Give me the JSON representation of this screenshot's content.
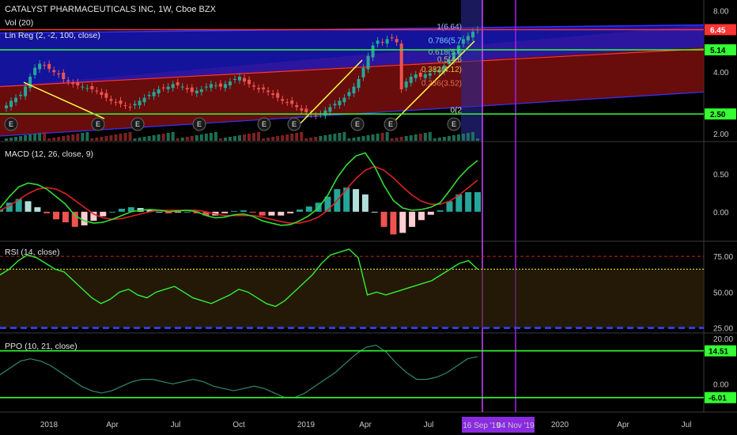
{
  "header": {
    "title": "CATALYST PHARMACEUTICALS INC, 1W, Cboe BZX",
    "vol_label": "Vol (20)",
    "linreg_label": "Lin Reg (2, -2, 100, close)"
  },
  "indicators": {
    "macd_label": "MACD (12, 26, close, 9)",
    "rsi_label": "RSI (14, close)",
    "ppo_label": "PPO (10, 21, close)"
  },
  "colors": {
    "background": "#000000",
    "bull_candle": "#26a69a",
    "bear_candle": "#ef5350",
    "horizontal_green": "#33ff33",
    "horizontal_red": "#ff3333",
    "trend_yellow": "#ffff44",
    "linreg_blue": "#1a1ad0",
    "linreg_red": "#8b1010",
    "macd_line": "#33dd33",
    "signal_line": "#dd2222",
    "rsi_line": "#33ee33",
    "ppo_line": "#2e8b6e",
    "vertical_purple": "#a020f0",
    "highlight_purple": "#8a2be2"
  },
  "chart_data": [
    {
      "type": "candlestick",
      "pane": "price",
      "scale": "log",
      "y_ticks": [
        "8.00",
        "4.00",
        "2.00"
      ],
      "ylim": [
        1.85,
        9.0
      ],
      "horizontal_levels": [
        {
          "value": 6.45,
          "label": "6.45",
          "color": "#ff3333"
        },
        {
          "value": 5.14,
          "label": "5.14",
          "color": "#33ff33"
        },
        {
          "value": 2.5,
          "label": "2.50",
          "color": "#33ff33"
        }
      ],
      "fib_levels": [
        {
          "label": "1(6.64)",
          "value": 6.64
        },
        {
          "label": "0.786(5.7",
          "value": 5.7
        },
        {
          "label": "0.618(5.0",
          "value": 5.0
        },
        {
          "label": "0.5(4.6",
          "value": 4.6
        },
        {
          "label": "0.382(4.12)",
          "value": 4.12
        },
        {
          "label": "0.236(3.52)",
          "value": 3.52
        },
        {
          "label": "0(2",
          "value": 2.6
        }
      ],
      "earnings_marker": "E",
      "weekly_close": [
        2.75,
        2.9,
        3.0,
        3.1,
        3.4,
        3.8,
        4.2,
        4.4,
        4.3,
        4.15,
        4.0,
        3.9,
        3.7,
        3.6,
        3.5,
        3.45,
        3.4,
        3.35,
        3.3,
        3.25,
        3.1,
        3.0,
        2.9,
        2.85,
        2.8,
        2.75,
        2.7,
        2.8,
        2.9,
        3.0,
        3.1,
        3.2,
        3.3,
        3.35,
        3.4,
        3.5,
        3.45,
        3.4,
        3.3,
        3.2,
        3.25,
        3.3,
        3.4,
        3.5,
        3.45,
        3.4,
        3.5,
        3.6,
        3.7,
        3.8,
        3.6,
        3.5,
        3.4,
        3.3,
        3.3,
        3.2,
        3.1,
        3.0,
        2.9,
        2.85,
        2.8,
        2.7,
        2.6,
        2.55,
        2.5,
        2.45,
        2.5,
        2.6,
        2.7,
        2.8,
        2.9,
        3.0,
        3.2,
        3.4,
        3.7,
        4.2,
        4.8,
        5.4,
        5.7,
        5.6,
        5.8,
        5.9,
        5.6,
        3.3,
        3.6,
        3.8,
        3.9,
        3.8,
        3.9,
        3.95,
        4.05,
        4.1,
        4.3,
        4.6,
        5.0,
        5.4,
        5.8,
        6.0,
        6.3,
        6.45
      ]
    },
    {
      "type": "line",
      "pane": "macd",
      "y_ticks": [
        "0.50",
        "0.00"
      ],
      "ylim": [
        -0.38,
        0.92
      ],
      "series": [
        {
          "name": "MACD",
          "values": [
            0.05,
            0.2,
            0.33,
            0.38,
            0.36,
            0.3,
            0.2,
            0.1,
            -0.05,
            -0.12,
            -0.15,
            -0.14,
            -0.1,
            -0.05,
            0.0,
            0.02,
            0.03,
            0.02,
            0.0,
            0.01,
            0.02,
            0.0,
            -0.05,
            -0.08,
            -0.07,
            -0.04,
            -0.03,
            -0.06,
            -0.12,
            -0.15,
            -0.18,
            -0.17,
            -0.12,
            -0.05,
            0.05,
            0.22,
            0.45,
            0.62,
            0.74,
            0.78,
            0.6,
            0.35,
            0.15,
            0.05,
            0.02,
            0.03,
            0.06,
            0.12,
            0.28,
            0.45,
            0.58,
            0.68
          ]
        },
        {
          "name": "Signal",
          "values": [
            0.02,
            0.08,
            0.16,
            0.24,
            0.3,
            0.32,
            0.3,
            0.24,
            0.15,
            0.06,
            -0.03,
            -0.08,
            -0.1,
            -0.09,
            -0.06,
            -0.03,
            0.0,
            0.02,
            0.02,
            0.02,
            0.02,
            0.02,
            0.0,
            -0.03,
            -0.05,
            -0.05,
            -0.05,
            -0.05,
            -0.07,
            -0.1,
            -0.13,
            -0.15,
            -0.15,
            -0.12,
            -0.07,
            0.02,
            0.15,
            0.3,
            0.44,
            0.55,
            0.6,
            0.55,
            0.45,
            0.33,
            0.22,
            0.14,
            0.1,
            0.1,
            0.14,
            0.22,
            0.32,
            0.42
          ]
        }
      ]
    },
    {
      "type": "line",
      "pane": "rsi",
      "y_ticks": [
        "75.00",
        "50.00",
        "25.00"
      ],
      "ylim": [
        22,
        85
      ],
      "reference_levels": [
        75,
        66,
        25
      ],
      "series": [
        {
          "name": "RSI",
          "values": [
            62,
            66,
            72,
            76,
            74,
            70,
            66,
            64,
            58,
            52,
            46,
            42,
            45,
            50,
            52,
            48,
            46,
            50,
            52,
            54,
            50,
            46,
            44,
            42,
            45,
            48,
            52,
            50,
            46,
            42,
            40,
            44,
            50,
            56,
            62,
            70,
            76,
            78,
            80,
            74,
            48,
            50,
            48,
            50,
            52,
            54,
            56,
            58,
            62,
            66,
            70,
            72,
            66
          ]
        }
      ]
    },
    {
      "type": "line",
      "pane": "ppo",
      "y_ticks": [
        "20.00",
        "0.00"
      ],
      "ylim": [
        -12,
        22
      ],
      "horizontal_levels": [
        {
          "value": 14.51,
          "label": "14.51",
          "color": "#33ff33"
        },
        {
          "value": -6.01,
          "label": "-6.01",
          "color": "#33ff33"
        }
      ],
      "series": [
        {
          "name": "PPO",
          "values": [
            4,
            7,
            10,
            11,
            10,
            8,
            5,
            2,
            -1,
            -3,
            -4,
            -3,
            -1,
            1,
            2,
            2,
            1,
            0,
            1,
            2,
            1,
            -1,
            -2,
            -3,
            -2,
            -1,
            -2,
            -4,
            -6,
            -6,
            -4,
            -1,
            2,
            5,
            9,
            13,
            16,
            17,
            14,
            9,
            5,
            2,
            2,
            3,
            5,
            8,
            11,
            12
          ]
        }
      ]
    }
  ],
  "x_axis": {
    "labels": [
      "2018",
      "Apr",
      "Jul",
      "Oct",
      "2019",
      "Apr",
      "Jul",
      "2020",
      "Apr",
      "Jul"
    ],
    "highlight_labels": [
      "16 Sep '19",
      "04 Nov '19"
    ]
  }
}
